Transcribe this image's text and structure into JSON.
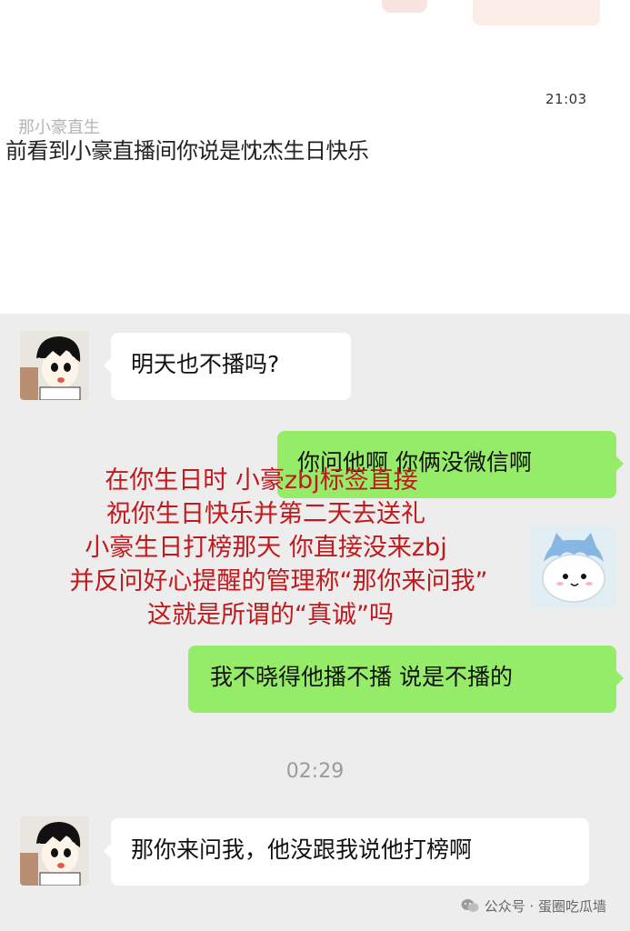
{
  "top": {
    "timestamp": "21:03",
    "message": "前看到小豪直播间你说是忱杰生日快乐",
    "ghost_text": "那小豪直生"
  },
  "chat": {
    "messages": [
      {
        "side": "left",
        "text": "明天也不播吗?"
      },
      {
        "side": "right",
        "text": "你问他啊 你俩没微信啊"
      },
      {
        "side": "right",
        "text": "我不晓得他播不播 说是不播的"
      },
      {
        "side": "left",
        "text": "那你来问我，他没跟我说他打榜啊"
      }
    ],
    "time_divider": "02:29"
  },
  "overlay_lines": [
    "在你生日时 小豪zbj标签直接",
    "祝你生日快乐并第二天去送礼",
    "小豪生日打榜那天 你直接没来zbj",
    "并反问好心提醒的管理称“那你来问我”",
    "这就是所谓的“真诚”吗"
  ],
  "watermark": "公众号 · 蛋圈吃瓜墙",
  "colors": {
    "chat_background": "#ededed",
    "right_bubble": "#95ec69",
    "left_bubble": "#ffffff",
    "overlay_text": "#c2191d"
  },
  "icons": [
    "avatar-cartoon-boy",
    "sticker-cat",
    "wechat-icon"
  ]
}
